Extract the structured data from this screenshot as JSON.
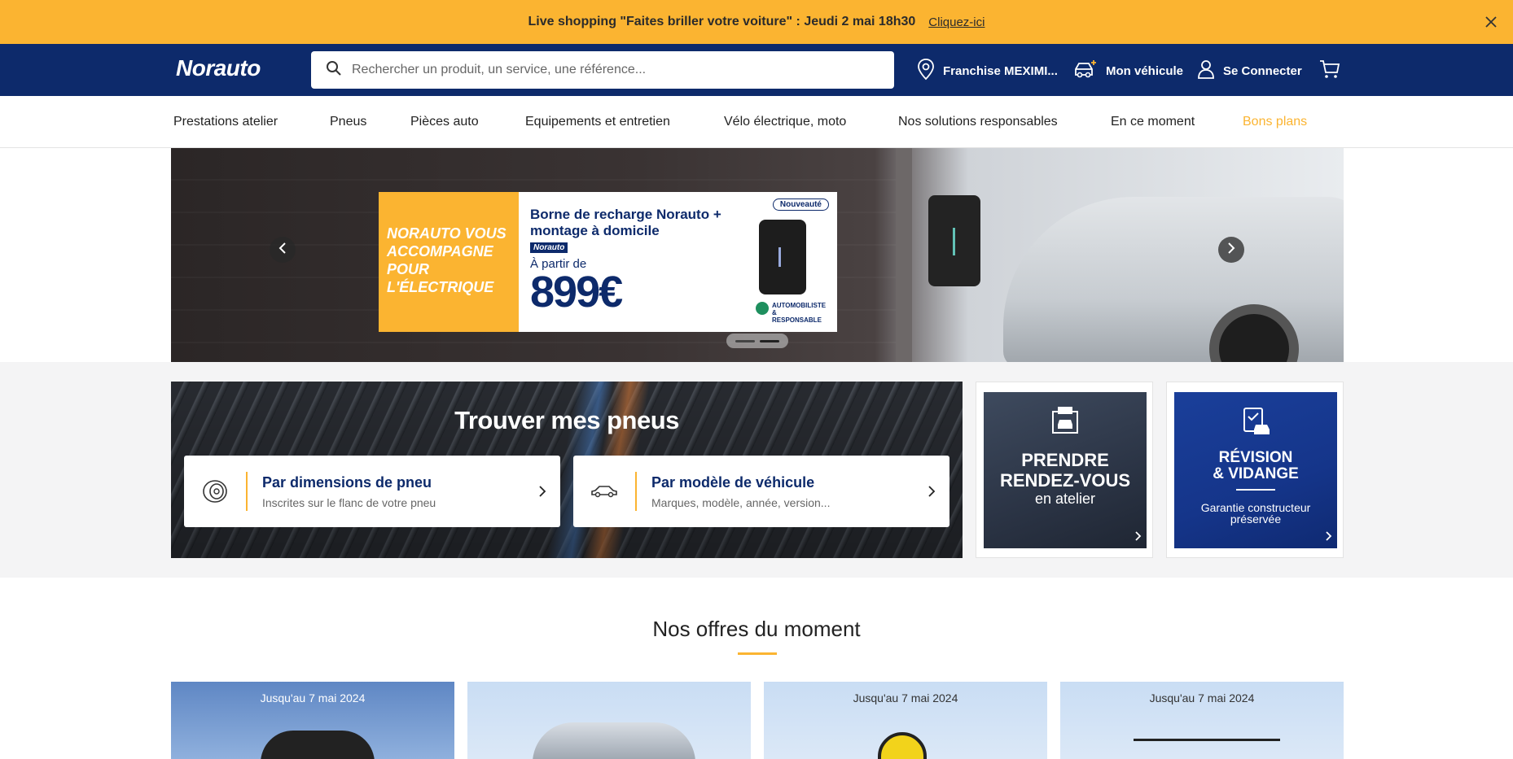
{
  "promo": {
    "message": "Live shopping \"Faites briller votre voiture\" : Jeudi 2 mai 18h30",
    "link": "Cliquez-ici"
  },
  "header": {
    "logo_main": "Norauto",
    "search_placeholder": "Rechercher un produit, un service, une référence...",
    "store": "Franchise MEXIMI...",
    "vehicle": "Mon véhicule",
    "login": "Se Connecter"
  },
  "nav": {
    "items": [
      "Prestations atelier",
      "Pneus",
      "Pièces auto",
      "Equipements et entretien",
      "Vélo électrique, moto",
      "Nos solutions responsables",
      "En ce moment",
      "Bons plans"
    ]
  },
  "hero": {
    "left_text": "NORAUTO VOUS ACCOMPAGNE POUR L'ÉLECTRIQUE",
    "title": "Borne de recharge Norauto + montage à domicile",
    "mini_logo": "Norauto",
    "from": "À partir de",
    "price": "899€",
    "new_badge": "Nouveauté",
    "eco_badge": "AUTOMOBILISTE & RESPONSABLE",
    "slides": 2,
    "active_slide": 2
  },
  "tires": {
    "title": "Trouver mes pneus",
    "by_size_title": "Par dimensions de pneu",
    "by_size_sub": "Inscrites sur le flanc de votre pneu",
    "by_vehicle_title": "Par modèle de véhicule",
    "by_vehicle_sub": "Marques, modèle, année, version..."
  },
  "promo_cards": {
    "appointment_l1": "PRENDRE",
    "appointment_l2": "RENDEZ-VOUS",
    "appointment_l3": "en atelier",
    "revision_l1": "RÉVISION",
    "revision_l2": "& VIDANGE",
    "revision_sub": "Garantie constructeur préservée"
  },
  "offers": {
    "title": "Nos offres du moment",
    "cards": [
      {
        "date": "Jusqu'au 7 mai 2024"
      },
      {
        "date": ""
      },
      {
        "date": "Jusqu'au 7 mai 2024"
      },
      {
        "date": "Jusqu'au 7 mai 2024"
      }
    ]
  },
  "colors": {
    "brand_blue": "#0d2a6b",
    "brand_yellow": "#fbb431"
  }
}
